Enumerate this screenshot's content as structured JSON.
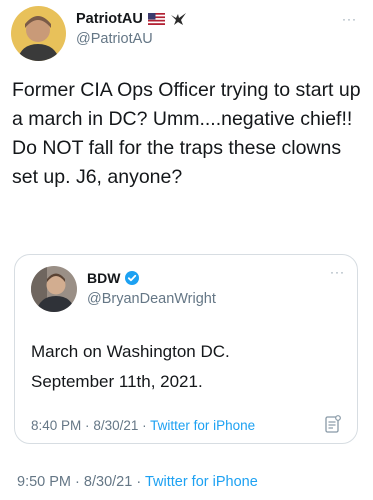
{
  "tweet": {
    "display_name": "PatriotAU",
    "handle": "@PatriotAU",
    "more_label": "···",
    "text": "Former CIA Ops Officer trying to start up a march in DC? Umm....negative chief!! Do NOT fall for the traps these clowns set up. J6, anyone?",
    "time": "9:50 PM",
    "date": "8/30/21",
    "separator": "·",
    "source": "Twitter for iPhone",
    "icons": [
      "avatar",
      "us-flag-icon",
      "eagle-icon",
      "more-icon"
    ]
  },
  "quoted": {
    "display_name": "BDW",
    "handle": "@BryanDeanWright",
    "more_label": "···",
    "text": "March on Washington DC.\nSeptember 11th, 2021.",
    "time": "8:40 PM",
    "date": "8/30/21",
    "separator": "·",
    "source": "Twitter for iPhone",
    "icons": [
      "avatar",
      "verified-badge-icon",
      "more-icon",
      "analytics-icon"
    ]
  },
  "colors": {
    "text": "#14171a",
    "secondary": "#657786",
    "link": "#1da1f2",
    "border": "#d7dde2",
    "verified": "#1da1f2"
  }
}
